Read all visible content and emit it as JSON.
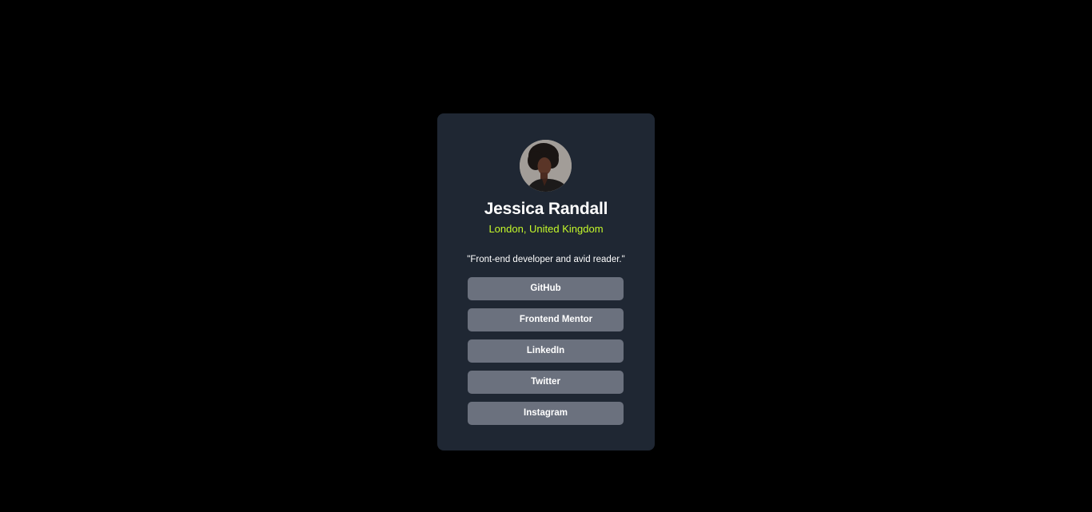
{
  "profile": {
    "name": "Jessica Randall",
    "location": "London, United Kingdom",
    "bio": "\"Front-end developer and avid reader.\""
  },
  "links": [
    {
      "label": "GitHub"
    },
    {
      "label": "Frontend Mentor"
    },
    {
      "label": "LinkedIn"
    },
    {
      "label": "Twitter"
    },
    {
      "label": "Instagram"
    }
  ],
  "colors": {
    "page_background": "#000000",
    "card_background": "#1f2733",
    "accent": "#c4f82a",
    "button_background": "#6b717e",
    "text": "#ffffff"
  }
}
